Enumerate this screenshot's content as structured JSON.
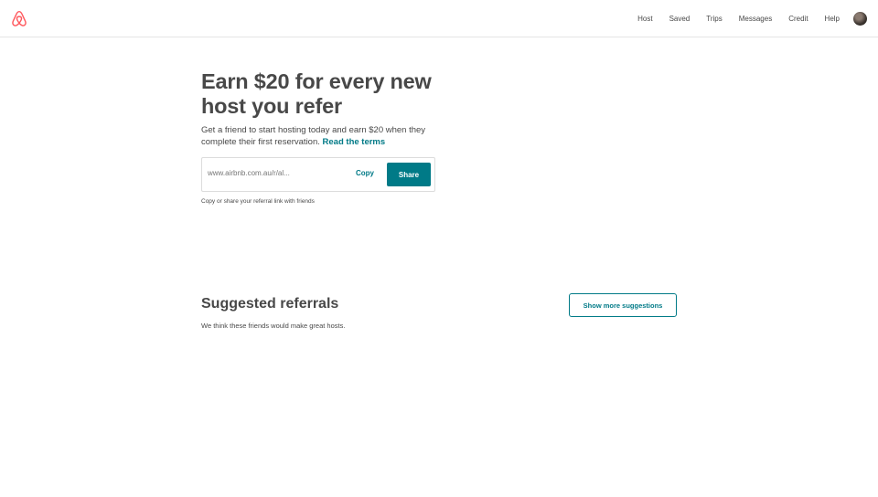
{
  "brand": {
    "accent": "#007a87",
    "logo_color": "#ff5a5f"
  },
  "header": {
    "logo_icon": "airbnb-belo-icon",
    "nav": [
      {
        "id": "host",
        "label": "Host"
      },
      {
        "id": "saved",
        "label": "Saved"
      },
      {
        "id": "trips",
        "label": "Trips"
      },
      {
        "id": "messages",
        "label": "Messages"
      },
      {
        "id": "credit",
        "label": "Credit"
      },
      {
        "id": "help",
        "label": "Help"
      }
    ]
  },
  "hero": {
    "title": "Earn $20 for every new host you refer",
    "description": "Get a friend to start hosting today and earn $20 when they complete their first reservation.",
    "terms_link": "Read the terms"
  },
  "referral": {
    "url": "www.airbnb.com.au/r/al...",
    "copy_label": "Copy",
    "share_label": "Share",
    "helper_text": "Copy or share your referral link with friends"
  },
  "suggested": {
    "title": "Suggested referrals",
    "subtitle": "We think these friends would make great hosts.",
    "more_button": "Show more suggestions"
  }
}
